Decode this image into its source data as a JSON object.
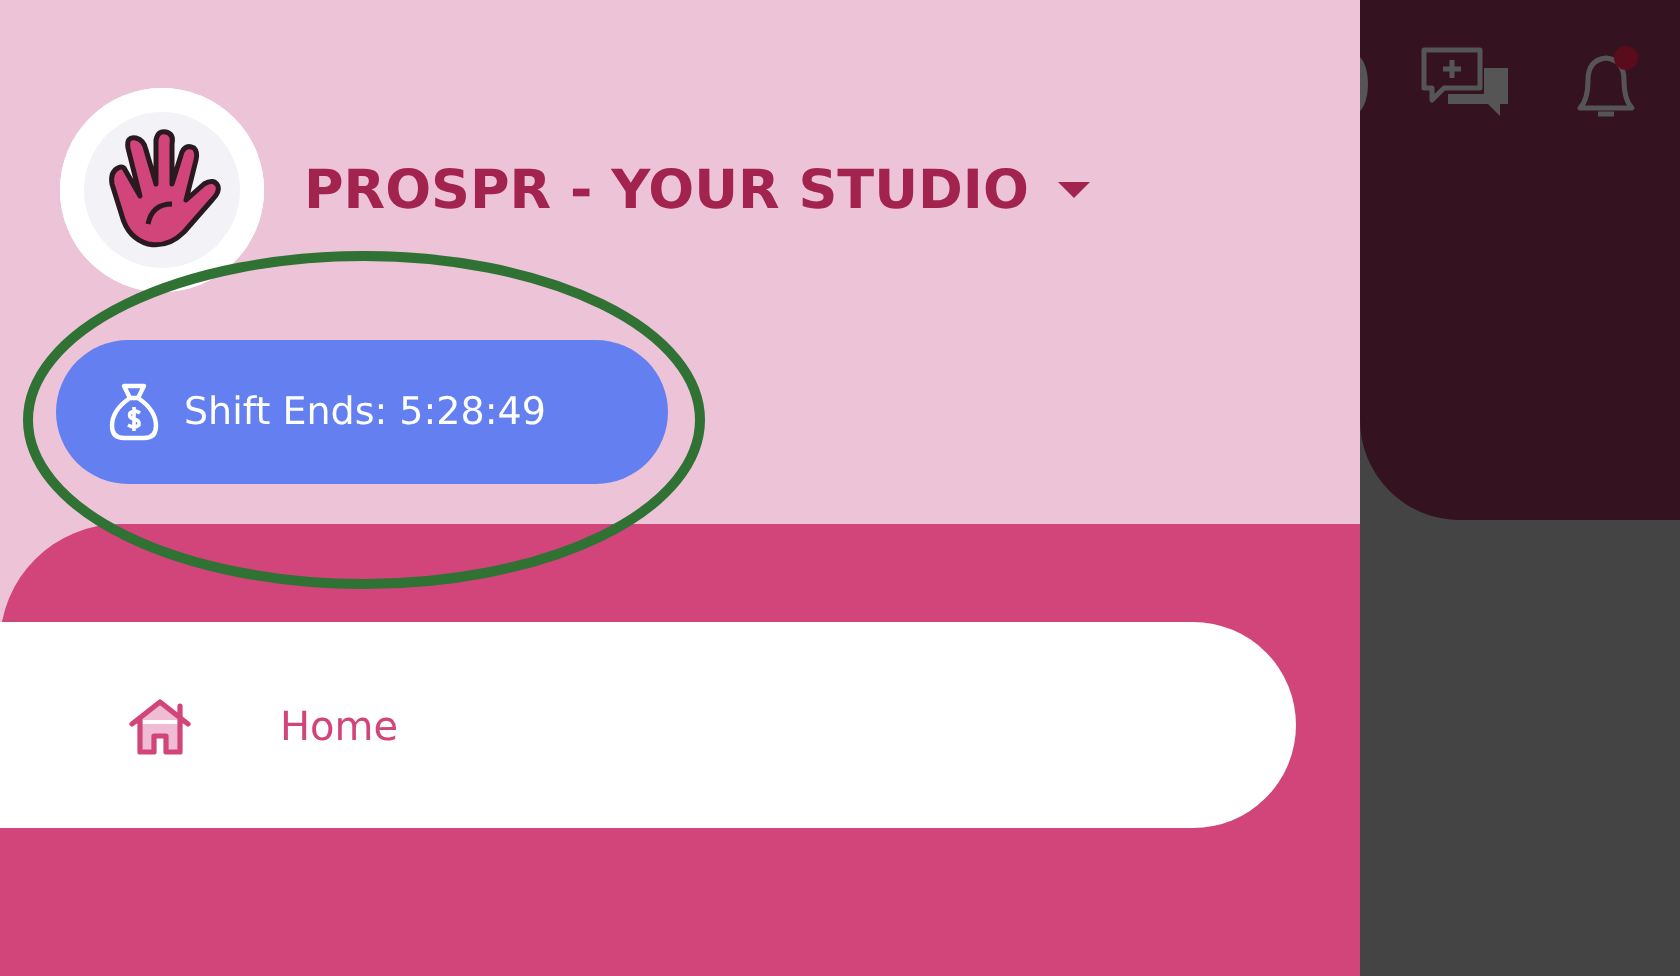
{
  "studio": {
    "name": "PROSPR - YOUR STUDIO"
  },
  "shift_button": {
    "label": "Shift Ends: 5:28:49",
    "highlighted": true
  },
  "nav": {
    "items": [
      {
        "label": "Home",
        "selected": true
      }
    ]
  },
  "header": {
    "has_notification": true
  }
}
